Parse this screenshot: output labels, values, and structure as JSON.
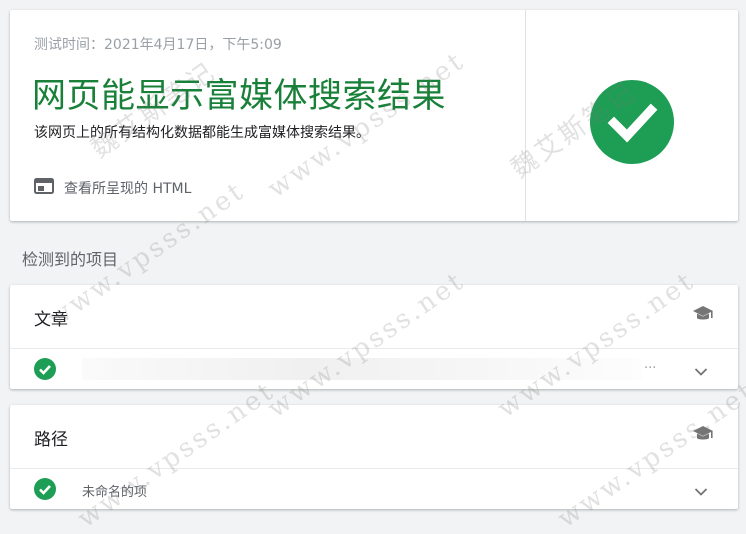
{
  "summary": {
    "test_time": "测试时间：2021年4月17日，下午5:09",
    "result_title": "网页能显示富媒体搜索结果",
    "result_desc": "该网页上的所有结构化数据都能生成富媒体搜索结果。",
    "view_html_label": "查看所呈现的 HTML",
    "status_color": "#1e9e55",
    "title_color": "#188038"
  },
  "section_label": "检测到的项目",
  "items": [
    {
      "title": "文章",
      "row_text": "",
      "ellipsis": "...",
      "icon": "graduation-cap-icon"
    },
    {
      "title": "路径",
      "row_text": "未命名的项",
      "ellipsis": "",
      "icon": "graduation-cap-icon"
    }
  ],
  "watermark": {
    "cn": "魏艾斯笔记",
    "url": "www.vpsss.net"
  }
}
